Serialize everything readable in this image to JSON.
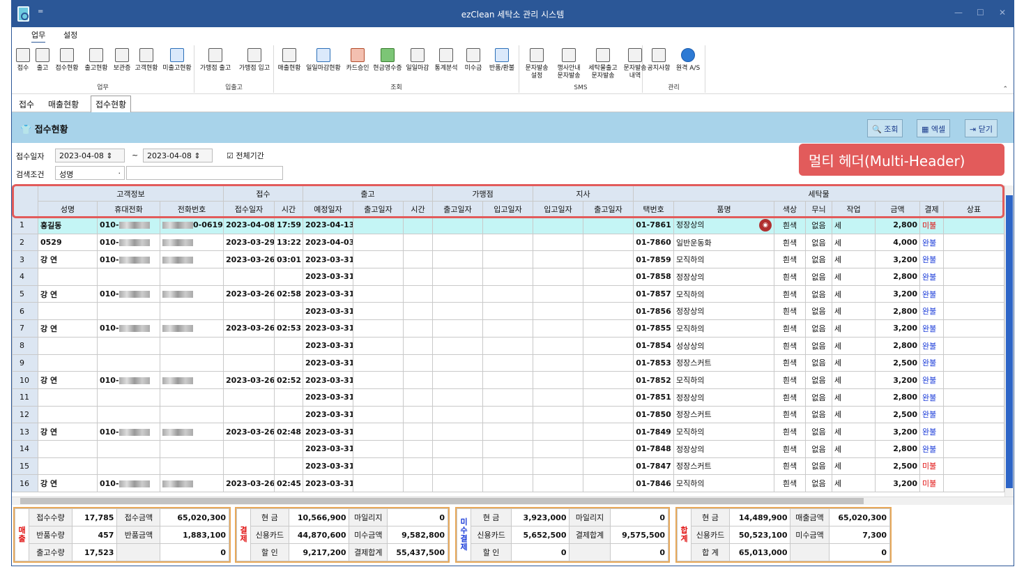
{
  "window": {
    "title": "ezClean 세탁소 관리 시스템",
    "quick_access": "="
  },
  "menu_tabs": [
    {
      "label": "업무",
      "active": true
    },
    {
      "label": "설정",
      "active": false
    }
  ],
  "ribbon": {
    "groups": [
      {
        "label": "업무",
        "buttons": [
          "접수",
          "출고",
          "접수현황",
          "출고현황",
          "보관증",
          "고객현황",
          "미출고현황"
        ]
      },
      {
        "label": "입출고",
        "buttons": [
          "가맹점 출고",
          "가맹점 입고"
        ]
      },
      {
        "label": "조회",
        "buttons": [
          "매출현황",
          "일일마감현황",
          "카드승인",
          "현금영수증",
          "일일마감",
          "통계분석",
          "미수금",
          "반품/환불"
        ]
      },
      {
        "label": "SMS",
        "buttons": [
          "문자발송\n설정",
          "행사안내\n문자발송",
          "세탁물출고\n문자발송",
          "문자발송\n내역"
        ]
      },
      {
        "label": "관리",
        "buttons": [
          "공지사항",
          "원격 A/S"
        ]
      }
    ]
  },
  "doc_tabs": [
    {
      "label": "접수",
      "active": false
    },
    {
      "label": "매출현황",
      "active": false
    },
    {
      "label": "접수현황",
      "active": true
    }
  ],
  "panel": {
    "title": "접수현황",
    "buttons": {
      "search": "조회",
      "excel": "엑셀",
      "close": "닫기"
    }
  },
  "filters": {
    "date_label": "접수일자",
    "date_from": "2023-04-08",
    "date_to": "2023-04-08",
    "tilde": "~",
    "all_period": "전체기간",
    "search_label": "검색조건",
    "search_field": "성명",
    "search_value": ""
  },
  "callout": "멀티 헤더(Multi-Header)",
  "grid": {
    "group_headers": [
      "고객정보",
      "접수",
      "출고",
      "가맹점",
      "지사",
      "세탁물"
    ],
    "columns": [
      "성명",
      "휴대전화",
      "전화번호",
      "접수일자",
      "시간",
      "예정일자",
      "출고일자",
      "시간",
      "출고일자",
      "입고일자",
      "입고일자",
      "출고일자",
      "택번호",
      "품명",
      "색상",
      "무늬",
      "작업",
      "금액",
      "결제",
      "상표"
    ],
    "rows": [
      {
        "no": "1",
        "name": "홍길동",
        "mobile": "010-",
        "phone": "0-0619",
        "date": "2023-04-08",
        "time": "17:59",
        "due": "2023-04-13",
        "tag": "01-7861",
        "item": "정장상의",
        "color": "흰색",
        "pattern": "없음",
        "work": "세",
        "amount": "2,800",
        "pay": "미불",
        "camera": true
      },
      {
        "no": "2",
        "name": "0529",
        "mobile": "010-",
        "phone": "",
        "date": "2023-03-29",
        "time": "13:22",
        "due": "2023-04-03",
        "tag": "01-7860",
        "item": "일반운동화",
        "color": "흰색",
        "pattern": "없음",
        "work": "세",
        "amount": "4,000",
        "pay": "완불"
      },
      {
        "no": "3",
        "name": "강 연",
        "mobile": "010-",
        "phone": "",
        "date": "2023-03-26",
        "time": "03:01",
        "due": "2023-03-31",
        "tag": "01-7859",
        "item": "모직하의",
        "color": "흰색",
        "pattern": "없음",
        "work": "세",
        "amount": "3,200",
        "pay": "완불"
      },
      {
        "no": "4",
        "name": "",
        "mobile": "",
        "phone": "",
        "date": "",
        "time": "",
        "due": "2023-03-31",
        "tag": "01-7858",
        "item": "정장상의",
        "color": "흰색",
        "pattern": "없음",
        "work": "세",
        "amount": "2,800",
        "pay": "완불"
      },
      {
        "no": "5",
        "name": "강 연",
        "mobile": "010-",
        "phone": "",
        "date": "2023-03-26",
        "time": "02:58",
        "due": "2023-03-31",
        "tag": "01-7857",
        "item": "모직하의",
        "color": "흰색",
        "pattern": "없음",
        "work": "세",
        "amount": "3,200",
        "pay": "완불"
      },
      {
        "no": "6",
        "name": "",
        "mobile": "",
        "phone": "",
        "date": "",
        "time": "",
        "due": "2023-03-31",
        "tag": "01-7856",
        "item": "정장상의",
        "color": "흰색",
        "pattern": "없음",
        "work": "세",
        "amount": "2,800",
        "pay": "완불"
      },
      {
        "no": "7",
        "name": "강 연",
        "mobile": "010-",
        "phone": "",
        "date": "2023-03-26",
        "time": "02:53",
        "due": "2023-03-31",
        "tag": "01-7855",
        "item": "모직하의",
        "color": "흰색",
        "pattern": "없음",
        "work": "세",
        "amount": "3,200",
        "pay": "완불"
      },
      {
        "no": "8",
        "name": "",
        "mobile": "",
        "phone": "",
        "date": "",
        "time": "",
        "due": "2023-03-31",
        "tag": "01-7854",
        "item": "성상상의",
        "color": "흰색",
        "pattern": "없음",
        "work": "세",
        "amount": "2,800",
        "pay": "완불"
      },
      {
        "no": "9",
        "name": "",
        "mobile": "",
        "phone": "",
        "date": "",
        "time": "",
        "due": "2023-03-31",
        "tag": "01-7853",
        "item": "정장스커트",
        "color": "흰색",
        "pattern": "없음",
        "work": "세",
        "amount": "2,500",
        "pay": "완불"
      },
      {
        "no": "10",
        "name": "강 연",
        "mobile": "010-",
        "phone": "",
        "date": "2023-03-26",
        "time": "02:52",
        "due": "2023-03-31",
        "tag": "01-7852",
        "item": "모직하의",
        "color": "흰색",
        "pattern": "없음",
        "work": "세",
        "amount": "3,200",
        "pay": "완불"
      },
      {
        "no": "11",
        "name": "",
        "mobile": "",
        "phone": "",
        "date": "",
        "time": "",
        "due": "2023-03-31",
        "tag": "01-7851",
        "item": "정장상의",
        "color": "흰색",
        "pattern": "없음",
        "work": "세",
        "amount": "2,800",
        "pay": "완불"
      },
      {
        "no": "12",
        "name": "",
        "mobile": "",
        "phone": "",
        "date": "",
        "time": "",
        "due": "2023-03-31",
        "tag": "01-7850",
        "item": "정장스커트",
        "color": "흰색",
        "pattern": "없음",
        "work": "세",
        "amount": "2,500",
        "pay": "완불"
      },
      {
        "no": "13",
        "name": "강 연",
        "mobile": "010-",
        "phone": "",
        "date": "2023-03-26",
        "time": "02:48",
        "due": "2023-03-31",
        "tag": "01-7849",
        "item": "모직하의",
        "color": "흰색",
        "pattern": "없음",
        "work": "세",
        "amount": "3,200",
        "pay": "완불"
      },
      {
        "no": "14",
        "name": "",
        "mobile": "",
        "phone": "",
        "date": "",
        "time": "",
        "due": "2023-03-31",
        "tag": "01-7848",
        "item": "정장상의",
        "color": "흰색",
        "pattern": "없음",
        "work": "세",
        "amount": "2,800",
        "pay": "완불"
      },
      {
        "no": "15",
        "name": "",
        "mobile": "",
        "phone": "",
        "date": "",
        "time": "",
        "due": "2023-03-31",
        "tag": "01-7847",
        "item": "정장스커트",
        "color": "흰색",
        "pattern": "없음",
        "work": "세",
        "amount": "2,500",
        "pay": "미불"
      },
      {
        "no": "16",
        "name": "강 연",
        "mobile": "010-",
        "phone": "",
        "date": "2023-03-26",
        "time": "02:45",
        "due": "2023-03-31",
        "tag": "01-7846",
        "item": "모직하의",
        "color": "흰색",
        "pattern": "없음",
        "work": "세",
        "amount": "3,200",
        "pay": "미불"
      }
    ]
  },
  "summary": {
    "sales": {
      "title": "매\n출",
      "rows": [
        [
          "접수수량",
          "17,785",
          "접수금액",
          "65,020,300"
        ],
        [
          "반품수량",
          "457",
          "반품금액",
          "1,883,100"
        ],
        [
          "출고수량",
          "17,523",
          "",
          "0"
        ]
      ]
    },
    "payment": {
      "title": "결\n제",
      "rows": [
        [
          "현 금",
          "10,566,900",
          "마일리지",
          "0"
        ],
        [
          "신용카드",
          "44,870,600",
          "미수금액",
          "9,582,800"
        ],
        [
          "할 인",
          "9,217,200",
          "결제합계",
          "55,437,500"
        ]
      ]
    },
    "unpaid": {
      "title": "미\n수\n결\n제",
      "rows": [
        [
          "현 금",
          "3,923,000",
          "마일리지",
          "0"
        ],
        [
          "신용카드",
          "5,652,500",
          "결제합계",
          "9,575,500"
        ],
        [
          "할 인",
          "0",
          "",
          "0"
        ]
      ]
    },
    "total": {
      "title": "합\n계",
      "rows": [
        [
          "현 금",
          "14,489,900",
          "매출금액",
          "65,020,300"
        ],
        [
          "신용카드",
          "50,523,100",
          "미수금액",
          "7,300"
        ],
        [
          "합 계",
          "65,013,000",
          "",
          "0"
        ]
      ]
    }
  },
  "colors": {
    "titlebar": "#2b5797",
    "panel": "#a8d3ea",
    "header": "#dce6f2",
    "selected_row": "#c4f5f5",
    "callout": "#e25b5b",
    "summary_border": "#e8a95a",
    "paid": "#1a3bd8",
    "unpaid": "#e01010"
  }
}
